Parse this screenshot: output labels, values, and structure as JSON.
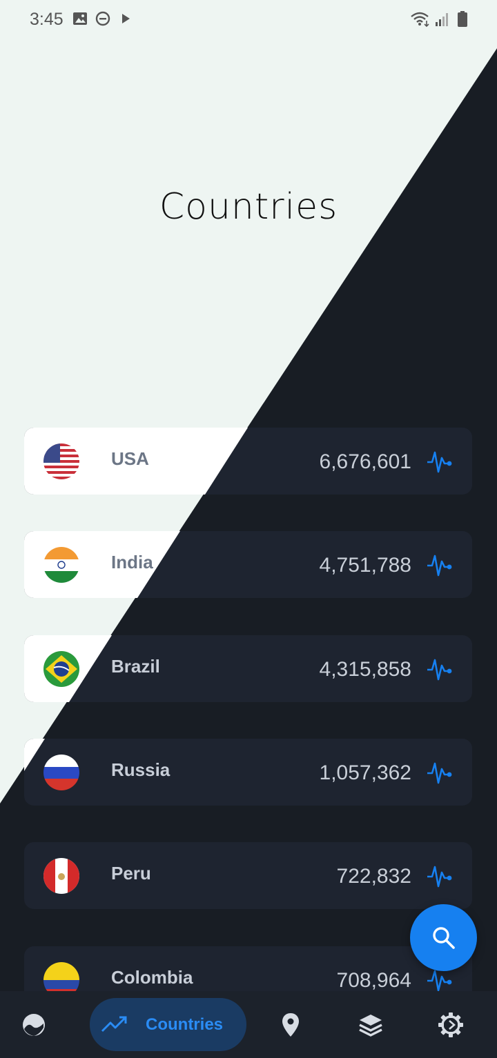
{
  "status_bar": {
    "time": "3:45",
    "icons": [
      "image-icon",
      "do-not-disturb-icon",
      "play-icon",
      "wifi-icon",
      "signal-icon",
      "battery-icon"
    ]
  },
  "page": {
    "title": "Countries"
  },
  "countries": [
    {
      "name": "USA",
      "count": "6,676,601",
      "flag": "usa-flag-icon"
    },
    {
      "name": "India",
      "count": "4,751,788",
      "flag": "india-flag-icon"
    },
    {
      "name": "Brazil",
      "count": "4,315,858",
      "flag": "brazil-flag-icon"
    },
    {
      "name": "Russia",
      "count": "1,057,362",
      "flag": "russia-flag-icon"
    },
    {
      "name": "Peru",
      "count": "722,832",
      "flag": "peru-flag-icon"
    },
    {
      "name": "Colombia",
      "count": "708,964",
      "flag": "colombia-flag-icon"
    }
  ],
  "fab": {
    "icon": "search-icon"
  },
  "bottom_nav": {
    "items": [
      {
        "icon": "globe-icon"
      },
      {
        "icon": "trending-up-icon",
        "label": "Countries",
        "active": true
      },
      {
        "icon": "location-pin-icon"
      },
      {
        "icon": "layers-icon"
      },
      {
        "icon": "settings-gear-icon"
      }
    ]
  },
  "colors": {
    "accent": "#1680f0",
    "dark_background": "#181d24",
    "light_background": "#eef5f2",
    "card_dark": "#1e2430",
    "card_light": "#ffffff"
  }
}
